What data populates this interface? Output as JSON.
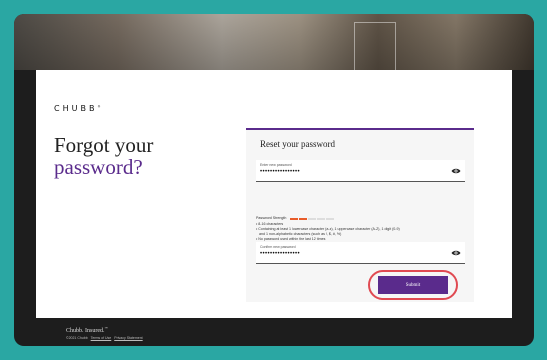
{
  "brand": {
    "logo": "CHUBB",
    "logo_mark": "®",
    "tagline": "Chubb. Insured.",
    "tagline_mark": "™"
  },
  "page": {
    "heading_line1": "Forgot your",
    "heading_line2": "password?"
  },
  "form": {
    "title": "Reset your password",
    "new_password": {
      "label": "Enter new password",
      "value": "••••••••••••••••"
    },
    "strength": {
      "label": "Password Strength",
      "level_filled": 2,
      "level_total": 5,
      "rules": [
        "• 8-16 characters",
        "• Containing at least 1 lowercase character (a-z), 1 uppercase character (A-Z), 1 digit (0-9)",
        "  and 1 non-alphabetic characters (such as !, $, #, %)",
        "• No password used within the last 12 times"
      ]
    },
    "confirm_password": {
      "label": "Confirm new password",
      "value": "••••••••••••••••"
    },
    "submit_label": "Submit"
  },
  "footer": {
    "copyright": "©2021 Chubb",
    "terms": "Terms of Use",
    "privacy": "Privacy Statement"
  },
  "colors": {
    "accent": "#5a2b8c",
    "highlight": "#e04a52",
    "strength_on": "#e85c2a",
    "background": "#2aa7a3"
  }
}
